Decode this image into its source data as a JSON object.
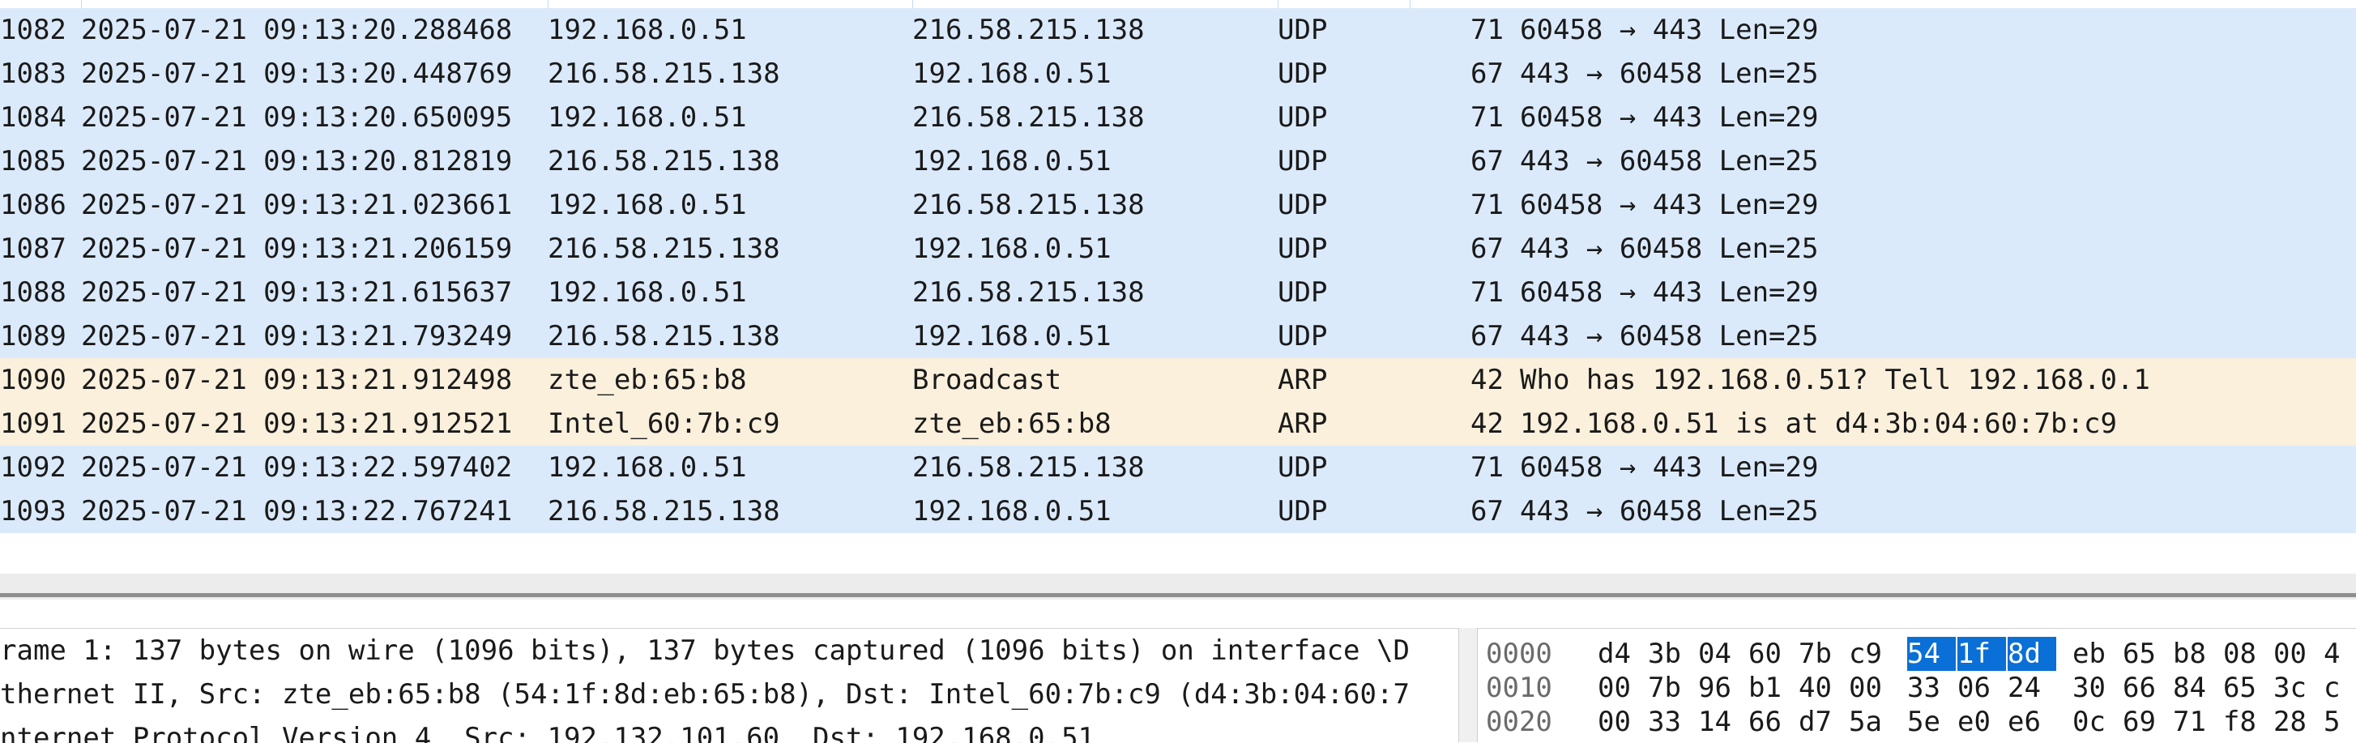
{
  "colors": {
    "udp_row_bg": "#dbeafb",
    "arp_row_bg": "#faf0dc",
    "selection_bg": "#0a6fd6",
    "offset_text": "#6b6b6b"
  },
  "packet_list": {
    "rows": [
      {
        "no": "1082",
        "time": "2025-07-21 09:13:20.288468",
        "src": "192.168.0.51",
        "dst": "216.58.215.138",
        "proto": "UDP",
        "len": "71",
        "info": "60458 → 443 Len=29"
      },
      {
        "no": "1083",
        "time": "2025-07-21 09:13:20.448769",
        "src": "216.58.215.138",
        "dst": "192.168.0.51",
        "proto": "UDP",
        "len": "67",
        "info": "443 → 60458 Len=25"
      },
      {
        "no": "1084",
        "time": "2025-07-21 09:13:20.650095",
        "src": "192.168.0.51",
        "dst": "216.58.215.138",
        "proto": "UDP",
        "len": "71",
        "info": "60458 → 443 Len=29"
      },
      {
        "no": "1085",
        "time": "2025-07-21 09:13:20.812819",
        "src": "216.58.215.138",
        "dst": "192.168.0.51",
        "proto": "UDP",
        "len": "67",
        "info": "443 → 60458 Len=25"
      },
      {
        "no": "1086",
        "time": "2025-07-21 09:13:21.023661",
        "src": "192.168.0.51",
        "dst": "216.58.215.138",
        "proto": "UDP",
        "len": "71",
        "info": "60458 → 443 Len=29"
      },
      {
        "no": "1087",
        "time": "2025-07-21 09:13:21.206159",
        "src": "216.58.215.138",
        "dst": "192.168.0.51",
        "proto": "UDP",
        "len": "67",
        "info": "443 → 60458 Len=25"
      },
      {
        "no": "1088",
        "time": "2025-07-21 09:13:21.615637",
        "src": "192.168.0.51",
        "dst": "216.58.215.138",
        "proto": "UDP",
        "len": "71",
        "info": "60458 → 443 Len=29"
      },
      {
        "no": "1089",
        "time": "2025-07-21 09:13:21.793249",
        "src": "216.58.215.138",
        "dst": "192.168.0.51",
        "proto": "UDP",
        "len": "67",
        "info": "443 → 60458 Len=25"
      },
      {
        "no": "1090",
        "time": "2025-07-21 09:13:21.912498",
        "src": "zte_eb:65:b8",
        "dst": "Broadcast",
        "proto": "ARP",
        "len": "42",
        "info": "Who has 192.168.0.51? Tell 192.168.0.1"
      },
      {
        "no": "1091",
        "time": "2025-07-21 09:13:21.912521",
        "src": "Intel_60:7b:c9",
        "dst": "zte_eb:65:b8",
        "proto": "ARP",
        "len": "42",
        "info": "192.168.0.51 is at d4:3b:04:60:7b:c9"
      },
      {
        "no": "1092",
        "time": "2025-07-21 09:13:22.597402",
        "src": "192.168.0.51",
        "dst": "216.58.215.138",
        "proto": "UDP",
        "len": "71",
        "info": "60458 → 443 Len=29"
      },
      {
        "no": "1093",
        "time": "2025-07-21 09:13:22.767241",
        "src": "216.58.215.138",
        "dst": "192.168.0.51",
        "proto": "UDP",
        "len": "67",
        "info": "443 → 60458 Len=25"
      }
    ]
  },
  "details": {
    "lines": [
      "rame 1: 137 bytes on wire (1096 bits), 137 bytes captured (1096 bits) on interface \\D",
      "thernet II, Src: zte_eb:65:b8 (54:1f:8d:eb:65:b8), Dst: Intel_60:7b:c9 (d4:3b:04:60:7",
      "nternet Protocol Version 4, Src: 192.132.101.60, Dst: 192.168.0.51"
    ]
  },
  "bytes": {
    "rows": [
      {
        "offset": "0000",
        "bytes": [
          "d4",
          "3b",
          "04",
          "60",
          "7b",
          "c9",
          "54",
          "1f",
          "8d",
          "eb",
          "65",
          "b8",
          "08",
          "00",
          "4"
        ],
        "selected": [
          6,
          7,
          8
        ]
      },
      {
        "offset": "0010",
        "bytes": [
          "00",
          "7b",
          "96",
          "b1",
          "40",
          "00",
          "33",
          "06",
          "24",
          "30",
          "66",
          "84",
          "65",
          "3c",
          "c"
        ],
        "selected": []
      },
      {
        "offset": "0020",
        "bytes": [
          "00",
          "33",
          "14",
          "66",
          "d7",
          "5a",
          "5e",
          "e0",
          "e6",
          "0c",
          "69",
          "71",
          "f8",
          "28",
          "5"
        ],
        "selected": []
      }
    ]
  }
}
